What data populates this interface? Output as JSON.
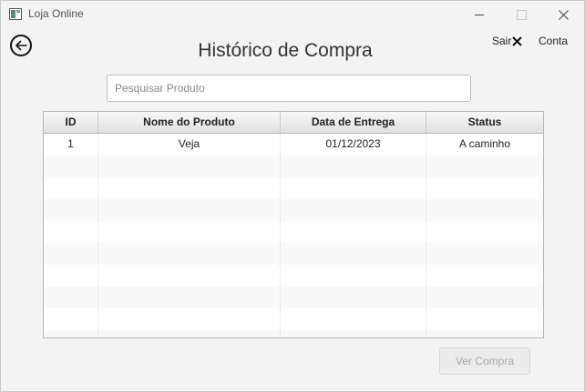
{
  "window": {
    "title": "Loja Online"
  },
  "header": {
    "title": "Histórico de Compra",
    "sair_label": "Sair",
    "conta_label": "Conta"
  },
  "search": {
    "placeholder": "Pesquisar Produto",
    "value": ""
  },
  "table": {
    "columns": [
      "ID",
      "Nome do Produto",
      "Data de Entrega",
      "Status"
    ],
    "rows": [
      [
        "1",
        "Veja",
        "01/12/2023",
        "A caminho"
      ]
    ],
    "empty_rows": 9
  },
  "footer": {
    "ver_compra_label": "Ver Compra",
    "ver_compra_enabled": false
  }
}
